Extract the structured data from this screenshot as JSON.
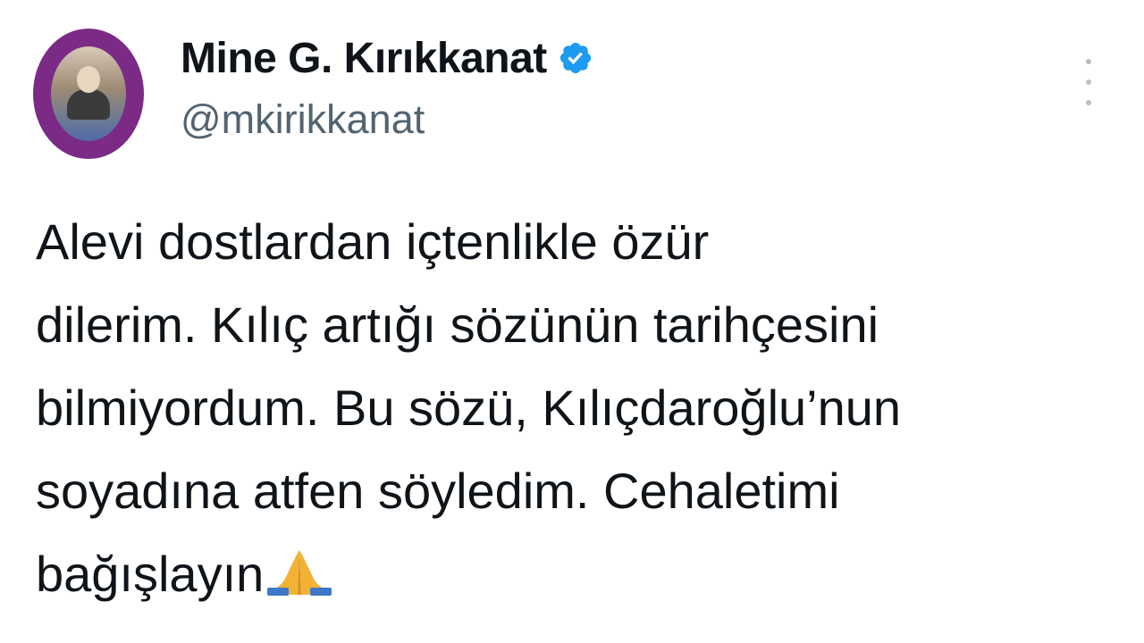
{
  "tweet": {
    "author": {
      "display_name": "Mine G. Kırıkkanat",
      "handle": "@mkirikkanat",
      "verified": true
    },
    "text_lines": [
      "Alevi dostlardan içtenlikle özür",
      "dilerim. Kılıç artığı sözünün tarihçesini",
      "bilmiyordum. Bu sözü, Kılıçdaroğlu’nun",
      "soyadına atfen söyledim. Cehaletimi",
      "bağışlayın"
    ],
    "trailing_emoji": "folded-hands-emoji"
  },
  "colors": {
    "text": "#0f1419",
    "secondary_text": "#536471",
    "verified_badge": "#1d9bf0",
    "avatar_ring": "#7b2a86"
  },
  "icons": {
    "more_menu": "more-vertical-icon",
    "verified": "verified-badge-icon"
  }
}
